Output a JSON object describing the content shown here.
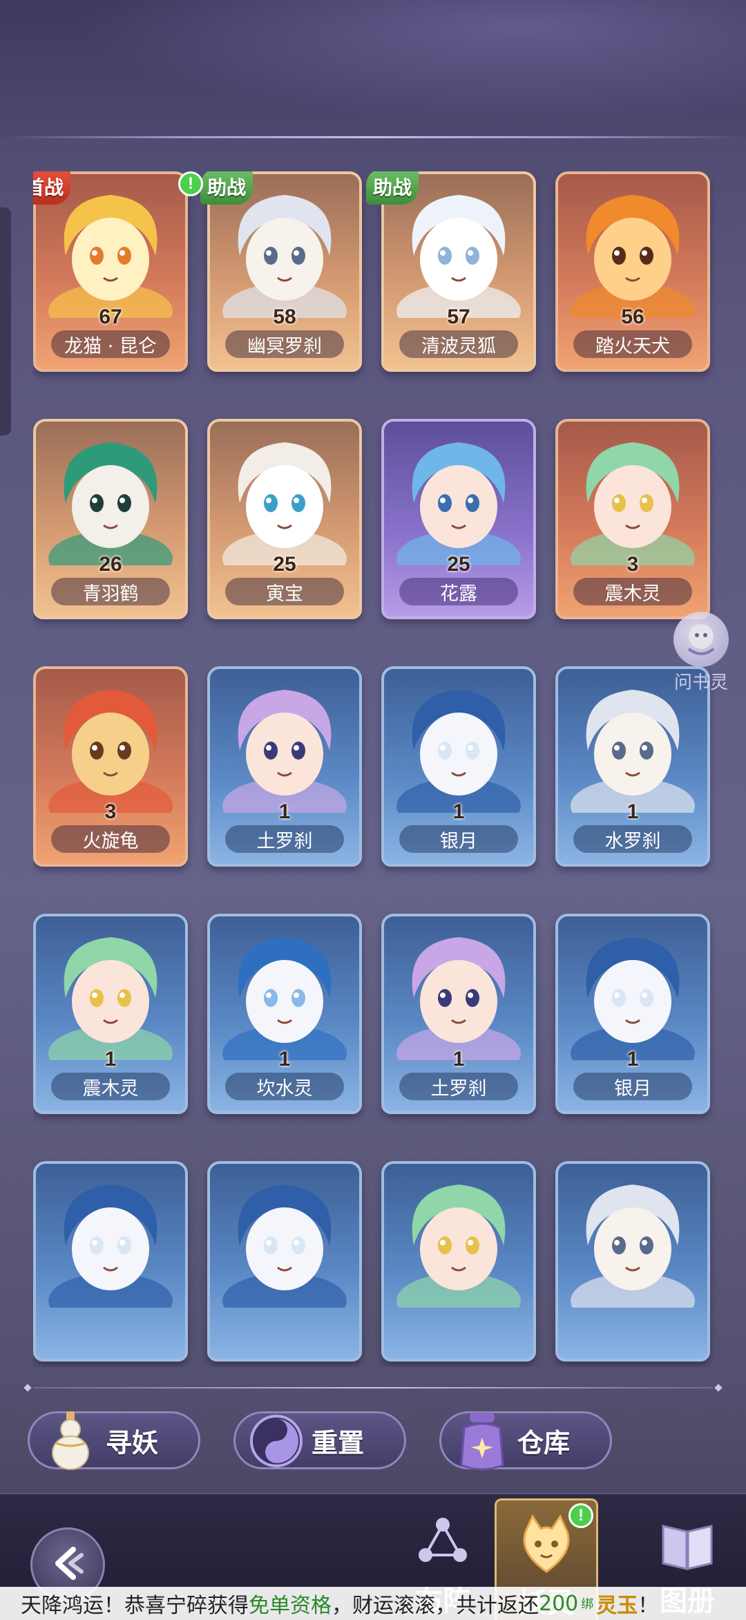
{
  "colors": {
    "tag_first": "#e8523c",
    "tag_assist": "#4ca046",
    "alert": "#4ccf4a",
    "ticker_highlight": "#2a8a2a",
    "ticker_gold": "#c98a00"
  },
  "cards": [
    {
      "name": "龙猫 · 昆仑",
      "level": "67",
      "rarity": "orange",
      "tag": "首战",
      "alert": false,
      "icon": "fox-spirit-portrait"
    },
    {
      "name": "幽冥罗刹",
      "level": "58",
      "rarity": "gold",
      "tag": "助战",
      "alert": true,
      "icon": "white-hair-girl-portrait"
    },
    {
      "name": "清波灵狐",
      "level": "57",
      "rarity": "gold",
      "tag": "助战",
      "alert": false,
      "icon": "white-wolf-portrait"
    },
    {
      "name": "踏火天犬",
      "level": "56",
      "rarity": "orange",
      "tag": "",
      "alert": false,
      "icon": "fire-dog-portrait"
    },
    {
      "name": "青羽鹤",
      "level": "26",
      "rarity": "gold",
      "tag": "",
      "alert": false,
      "icon": "crane-portrait"
    },
    {
      "name": "寅宝",
      "level": "25",
      "rarity": "gold",
      "tag": "",
      "alert": false,
      "icon": "tiger-cub-portrait"
    },
    {
      "name": "花露",
      "level": "25",
      "rarity": "purple",
      "tag": "",
      "alert": false,
      "icon": "blue-hair-girl-portrait"
    },
    {
      "name": "震木灵",
      "level": "3",
      "rarity": "orange",
      "tag": "",
      "alert": false,
      "icon": "green-hair-boy-portrait"
    },
    {
      "name": "火旋龟",
      "level": "3",
      "rarity": "orange",
      "tag": "",
      "alert": false,
      "icon": "fire-turtle-portrait"
    },
    {
      "name": "土罗刹",
      "level": "1",
      "rarity": "blue",
      "tag": "",
      "alert": false,
      "icon": "purple-hair-girl-portrait"
    },
    {
      "name": "银月",
      "level": "1",
      "rarity": "blue",
      "tag": "",
      "alert": false,
      "icon": "blue-wolf-portrait"
    },
    {
      "name": "水罗刹",
      "level": "1",
      "rarity": "blue",
      "tag": "",
      "alert": false,
      "icon": "white-hair-girl-portrait"
    },
    {
      "name": "震木灵",
      "level": "1",
      "rarity": "blue",
      "tag": "",
      "alert": false,
      "icon": "green-hair-boy-portrait"
    },
    {
      "name": "坎水灵",
      "level": "1",
      "rarity": "blue",
      "tag": "",
      "alert": false,
      "icon": "water-spirit-portrait"
    },
    {
      "name": "土罗刹",
      "level": "1",
      "rarity": "blue",
      "tag": "",
      "alert": false,
      "icon": "purple-hair-girl-portrait"
    },
    {
      "name": "银月",
      "level": "1",
      "rarity": "blue",
      "tag": "",
      "alert": false,
      "icon": "blue-wolf-portrait"
    },
    {
      "name": "",
      "level": "",
      "rarity": "blue",
      "tag": "",
      "alert": false,
      "icon": "blue-wolf-portrait"
    },
    {
      "name": "",
      "level": "",
      "rarity": "blue",
      "tag": "",
      "alert": false,
      "icon": "blue-wolf-portrait"
    },
    {
      "name": "",
      "level": "",
      "rarity": "blue",
      "tag": "",
      "alert": false,
      "icon": "green-hair-boy-portrait"
    },
    {
      "name": "",
      "level": "",
      "rarity": "blue",
      "tag": "",
      "alert": false,
      "icon": "white-hair-girl-portrait"
    }
  ],
  "floating_helper": {
    "label": "问书灵",
    "icon": "book-spirit-icon"
  },
  "actions": [
    {
      "label": "寻妖",
      "icon": "gourd-icon"
    },
    {
      "label": "重置",
      "icon": "swirl-orb-icon"
    },
    {
      "label": "仓库",
      "icon": "storage-jar-icon"
    }
  ],
  "bottom_nav": {
    "back_icon": "back-arrow-icon",
    "items": [
      {
        "label": "布阵",
        "icon": "formation-icon",
        "active": false,
        "alert": false
      },
      {
        "label": "妖灵",
        "icon": "spirit-cat-icon",
        "active": true,
        "alert": true
      },
      {
        "label": "图册",
        "icon": "book-icon",
        "active": false,
        "alert": false
      }
    ]
  },
  "ticker": {
    "prefix": "天降鸿运！恭喜宁碎获得",
    "highlight": "免单资格",
    "middle": "，财运滚滚，共计返还",
    "amount": "200",
    "badge": "绑",
    "currency": "灵玉",
    "suffix": "！"
  }
}
